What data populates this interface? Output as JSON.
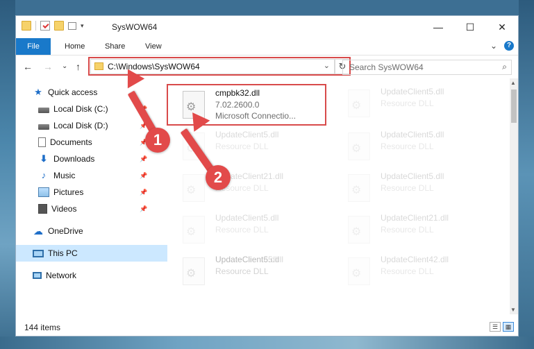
{
  "window": {
    "title": "SysWOW64"
  },
  "title_controls": {
    "minimize": "—",
    "maximize": "☐",
    "close": "✕"
  },
  "ribbon": {
    "tabs": [
      "File",
      "Home",
      "Share",
      "View"
    ],
    "expand": "⌄",
    "help": "?"
  },
  "nav": {
    "back": "←",
    "forward": "→",
    "recent": "⌄",
    "up": "↑"
  },
  "address": {
    "path": "C:\\Windows\\SysWOW64",
    "dropdown": "⌄",
    "refresh": "↻"
  },
  "search": {
    "placeholder": "Search SysWOW64",
    "icon": "⌕"
  },
  "sidebar": {
    "items": [
      {
        "label": "Quick access",
        "icon": "quick-access-star",
        "pinned": false
      },
      {
        "label": "Local Disk (C:)",
        "icon": "drive",
        "pinned": true
      },
      {
        "label": "Local Disk (D:)",
        "icon": "drive",
        "pinned": true
      },
      {
        "label": "Documents",
        "icon": "documents",
        "pinned": true
      },
      {
        "label": "Downloads",
        "icon": "downloads",
        "pinned": true
      },
      {
        "label": "Music",
        "icon": "music",
        "pinned": true
      },
      {
        "label": "Pictures",
        "icon": "pictures",
        "pinned": true
      },
      {
        "label": "Videos",
        "icon": "videos",
        "pinned": true
      },
      {
        "label": "OneDrive",
        "icon": "onedrive-cloud",
        "pinned": false
      },
      {
        "label": "This PC",
        "icon": "this-pc",
        "pinned": false,
        "selected": true
      },
      {
        "label": "Network",
        "icon": "network",
        "pinned": false
      }
    ],
    "pin_glyph": "📌"
  },
  "files": {
    "highlighted": {
      "name": "cmpbk32.dll",
      "version": "7.02.2600.0",
      "company": "Microsoft Connectio..."
    },
    "faded": [
      {
        "name": "UpdateClient5.dll",
        "type": "Resource DLL"
      },
      {
        "name": "UpdateClient5.dll",
        "type": "Resource DLL"
      },
      {
        "name": "UpdateClient5.dll",
        "type": "Resource DLL"
      },
      {
        "name": "UpdateClient21.dll",
        "type": "Resource DLL"
      },
      {
        "name": "UpdateClient5.dll",
        "type": "Resource DLL"
      },
      {
        "name": "UpdateClient5.dll",
        "type": "Resource DLL"
      },
      {
        "name": "UpdateClient65.dll",
        "type": "Resource DLL"
      },
      {
        "name": "UpdateClient21.dll",
        "type": "Resource DLL"
      },
      {
        "name": "UpdateClient5.dll",
        "type": "Resource DLL"
      },
      {
        "name": "UpdateClient42.dll",
        "type": "Resource DLL"
      }
    ]
  },
  "status": {
    "item_count": "144 items"
  },
  "annotations": {
    "step1": "1",
    "step2": "2",
    "color": "#e24a4a"
  }
}
